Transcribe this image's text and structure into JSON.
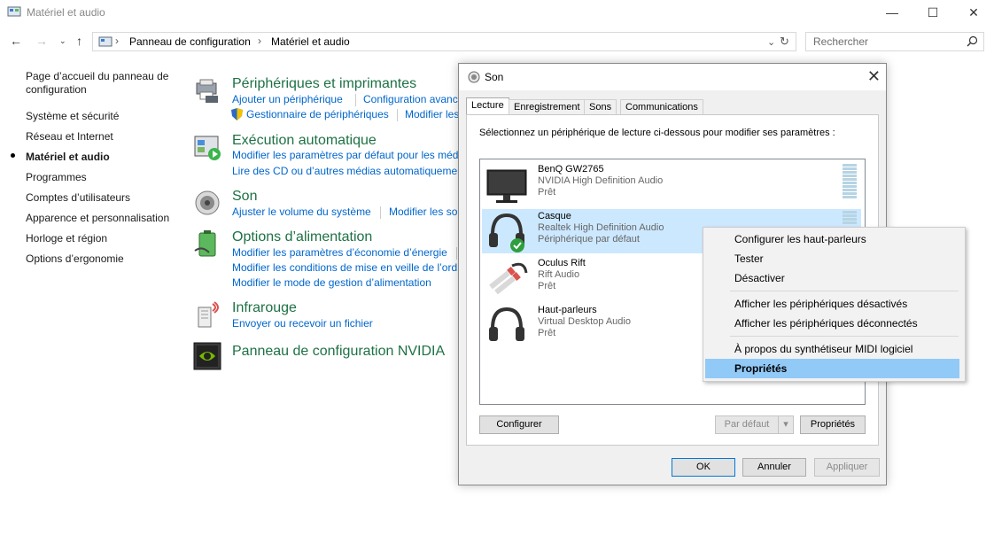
{
  "window": {
    "title": "Matériel et audio"
  },
  "address": {
    "breadcrumbs": [
      "Panneau de configuration",
      "Matériel et audio"
    ],
    "search_placeholder": "Rechercher"
  },
  "leftnav": {
    "items": [
      "Page d’accueil du panneau de",
      "configuration",
      "Système et sécurité",
      "Réseau et Internet",
      "Matériel et audio",
      "Programmes",
      "Comptes d’utilisateurs",
      "Apparence et personnalisation",
      "Horloge et région",
      "Options d’ergonomie"
    ]
  },
  "categories": {
    "devices": {
      "title": "Périphériques et imprimantes",
      "links": [
        "Ajouter un périphérique",
        "Configuration avancée",
        "Gestionnaire de périphériques",
        "Modifier les"
      ]
    },
    "autoplay": {
      "title": "Exécution automatique",
      "links": [
        "Modifier les paramètres par défaut pour les médi",
        "Lire des CD ou d’autres médias automatiquemer"
      ]
    },
    "sound": {
      "title": "Son",
      "links": [
        "Ajuster le volume du système",
        "Modifier les so"
      ]
    },
    "power": {
      "title": "Options d’alimentation",
      "links": [
        "Modifier les paramètres d’économie d’énergie",
        "Modifier les conditions de mise en veille de l’ord",
        "Modifier le mode de gestion d’alimentation"
      ]
    },
    "infrared": {
      "title": "Infrarouge",
      "links": [
        "Envoyer ou recevoir un fichier"
      ]
    },
    "nvidia": {
      "title": "Panneau de configuration NVIDIA"
    }
  },
  "dialog": {
    "title": "Son",
    "tabs": [
      "Lecture",
      "Enregistrement",
      "Sons",
      "Communications"
    ],
    "instruction": "Sélectionnez un périphérique de lecture ci-dessous pour modifier ses paramètres :",
    "devices": [
      {
        "name": "BenQ GW2765",
        "driver": "NVIDIA High Definition Audio",
        "status": "Prêt"
      },
      {
        "name": "Casque",
        "driver": "Realtek High Definition Audio",
        "status": "Périphérique par défaut"
      },
      {
        "name": "Oculus Rift",
        "driver": "Rift Audio",
        "status": "Prêt"
      },
      {
        "name": "Haut-parleurs",
        "driver": "Virtual Desktop Audio",
        "status": "Prêt"
      }
    ],
    "buttons": {
      "configure": "Configurer",
      "set_default": "Par défaut",
      "properties": "Propriétés",
      "ok": "OK",
      "cancel": "Annuler",
      "apply": "Appliquer"
    }
  },
  "context_menu": {
    "items": [
      "Configurer les haut-parleurs",
      "Tester",
      "Désactiver",
      "Afficher les périphériques désactivés",
      "Afficher les périphériques déconnectés",
      "À propos du synthétiseur MIDI logiciel",
      "Propriétés"
    ]
  },
  "colors": {
    "category_title": "#1e7145",
    "link": "#0066cc",
    "selection": "#cce8ff",
    "menu_highlight": "#91c9f7"
  }
}
